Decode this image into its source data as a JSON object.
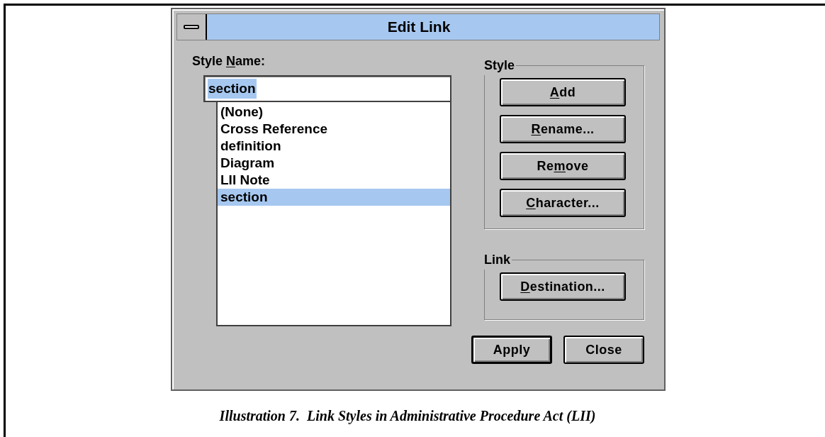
{
  "dialog": {
    "title": "Edit Link",
    "style_name": {
      "label": [
        {
          "text": "Style ",
          "underlined": false
        },
        {
          "text": "N",
          "underlined": true
        },
        {
          "text": "ame:",
          "underlined": false
        }
      ],
      "value": "section"
    },
    "list_items": [
      {
        "text": "(None)",
        "selected": false
      },
      {
        "text": "Cross Reference",
        "selected": false
      },
      {
        "text": "definition",
        "selected": false
      },
      {
        "text": "Diagram",
        "selected": false
      },
      {
        "text": "LII Note",
        "selected": false
      },
      {
        "text": "section",
        "selected": true
      }
    ],
    "groups": [
      {
        "title": "Style",
        "buttons": [
          {
            "label": [
              {
                "text": "A",
                "underlined": true
              },
              {
                "text": "dd",
                "underlined": false
              }
            ]
          },
          {
            "label": [
              {
                "text": "R",
                "underlined": true
              },
              {
                "text": "ename...",
                "underlined": false
              }
            ]
          },
          {
            "label": [
              {
                "text": "Re",
                "underlined": false
              },
              {
                "text": "m",
                "underlined": true
              },
              {
                "text": "ove",
                "underlined": false
              }
            ]
          },
          {
            "label": [
              {
                "text": "C",
                "underlined": true
              },
              {
                "text": "haracter...",
                "underlined": false
              }
            ]
          }
        ]
      },
      {
        "title": "Link",
        "buttons": [
          {
            "label": [
              {
                "text": "D",
                "underlined": true
              },
              {
                "text": "estination...",
                "underlined": false
              }
            ]
          }
        ]
      }
    ],
    "footer_buttons": [
      {
        "label": [
          {
            "text": "Apply",
            "underlined": false
          }
        ],
        "default": true
      },
      {
        "label": [
          {
            "text": "Close",
            "underlined": false
          }
        ],
        "default": false
      }
    ]
  },
  "caption": "Illustration 7.  Link Styles in Administrative Procedure Act (LII)"
}
